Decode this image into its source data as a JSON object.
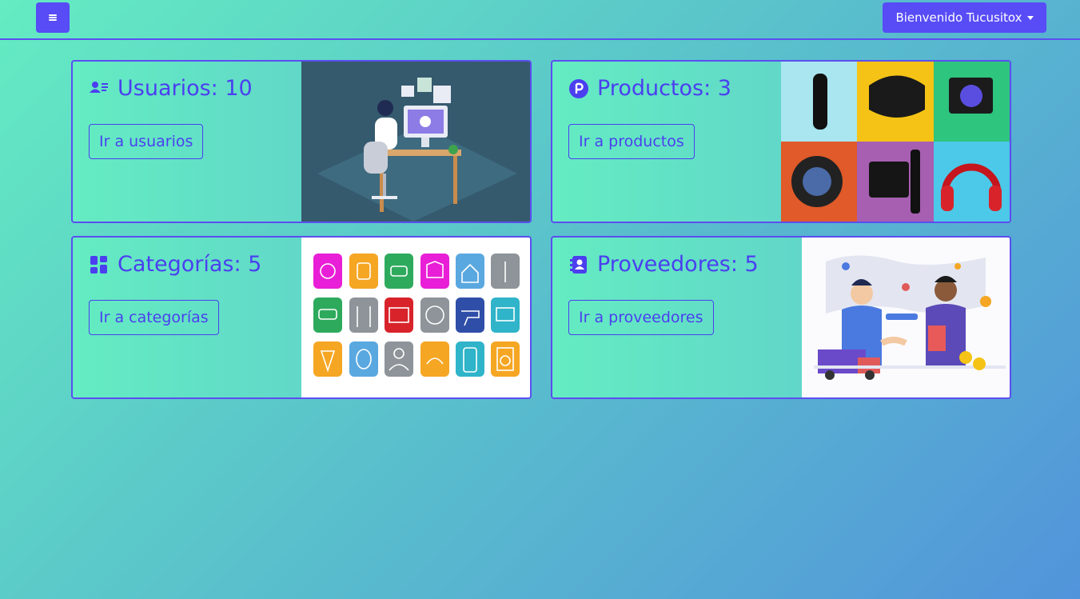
{
  "navbar": {
    "menu_icon": "bars-icon",
    "user_label": "Bienvenido Tucusitox"
  },
  "cards": {
    "usuarios": {
      "title": "Usuarios: 10",
      "link": "Ir a usuarios",
      "icon": "users-list-icon"
    },
    "productos": {
      "title": "Productos: 3",
      "link": "Ir a productos",
      "icon": "product-p-icon"
    },
    "categorias": {
      "title": "Categorías: 5",
      "link": "Ir a categorías",
      "icon": "grid-icon"
    },
    "proveedores": {
      "title": "Proveedores: 5",
      "link": "Ir a proveedores",
      "icon": "contact-book-icon"
    }
  },
  "colors": {
    "accent": "#574cf6",
    "text_accent": "#4b3fef",
    "gradient_start": "#64ecc2",
    "gradient_end": "#5294db"
  }
}
